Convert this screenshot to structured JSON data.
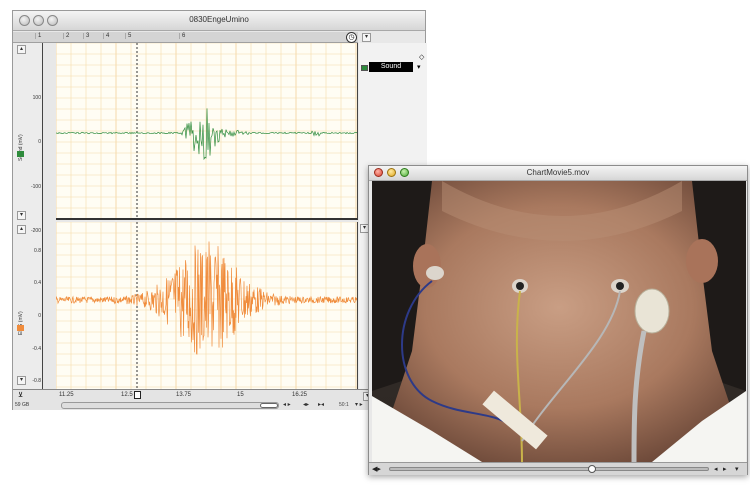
{
  "chart_window": {
    "title": "0830EngeUmino",
    "ruler_numbers": [
      "1",
      "2",
      "3",
      "4",
      "5",
      "6"
    ],
    "clock_icon": "clock-icon",
    "channels": [
      {
        "name": "Sound",
        "axis_label": "Sound (mV)",
        "color": "#2e8b3c",
        "ticks": [
          "100",
          "0",
          "-100",
          "-200"
        ]
      },
      {
        "name": "EMG",
        "axis_label": "EMG (mV)",
        "color": "#f08c3c",
        "ticks": [
          "0.8",
          "0.4",
          "0",
          "-0.4",
          "-0.8"
        ]
      }
    ],
    "channel_selector_label": "Sound",
    "x_ticks": [
      "11.25",
      "12.5",
      "13.75",
      "15",
      "16.25"
    ],
    "zoom": "50:1",
    "disk_label": "59 GB"
  },
  "movie_window": {
    "title": "ChartMovie5.mov",
    "play_position": 0.64
  }
}
